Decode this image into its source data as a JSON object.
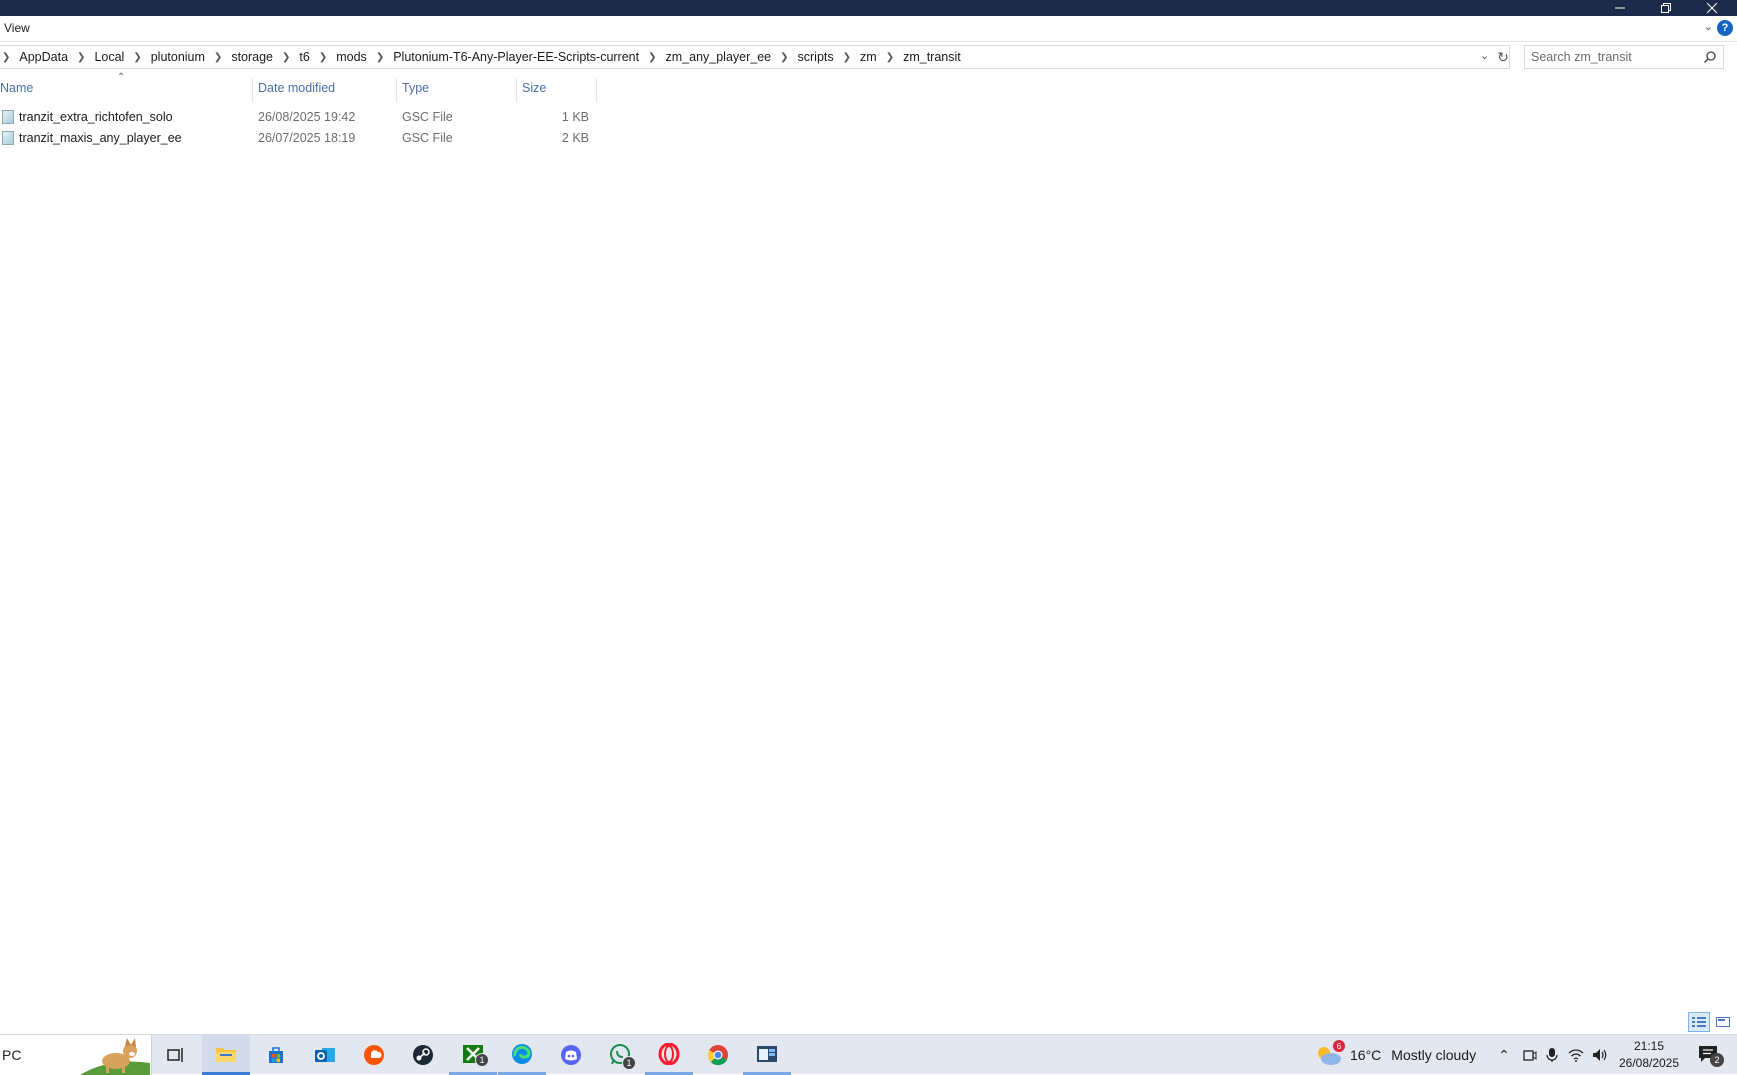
{
  "ribbon": {
    "view_tab": "View",
    "help_label": "?"
  },
  "address": {
    "crumbs": [
      "AppData",
      "Local",
      "plutonium",
      "storage",
      "t6",
      "mods",
      "Plutonium-T6-Any-Player-EE-Scripts-current",
      "zm_any_player_ee",
      "scripts",
      "zm",
      "zm_transit"
    ]
  },
  "search": {
    "placeholder": "Search zm_transit"
  },
  "columns": {
    "name": "Name",
    "date": "Date modified",
    "type": "Type",
    "size": "Size"
  },
  "files": [
    {
      "name": "tranzit_extra_richtofen_solo",
      "date": "26/08/2025 19:42",
      "type": "GSC File",
      "size": "1 KB"
    },
    {
      "name": "tranzit_maxis_any_player_ee",
      "date": "26/07/2025 18:19",
      "type": "GSC File",
      "size": "2 KB"
    }
  ],
  "taskbar": {
    "search_text": "PC",
    "apps": [
      "task-view",
      "file-explorer",
      "microsoft-store",
      "outlook",
      "soundcloud",
      "steam",
      "xbox",
      "edge",
      "discord",
      "whatsapp",
      "opera",
      "chrome",
      "app-window"
    ],
    "xbox_badge": "1",
    "whatsapp_badge": "1",
    "weather": {
      "badge": "6",
      "temp": "16°C",
      "condition": "Mostly cloudy"
    },
    "clock": {
      "time": "21:15",
      "date": "26/08/2025"
    },
    "notifications_badge": "2"
  },
  "colors": {
    "titlebar": "#1c2b4a",
    "accent": "#3b7bd6",
    "header_text": "#4a6fa5"
  }
}
